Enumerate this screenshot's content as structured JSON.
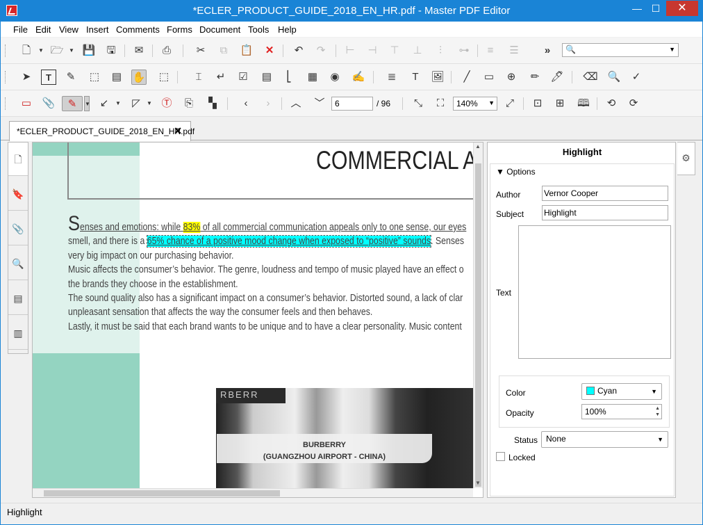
{
  "window": {
    "title": "*ECLER_PRODUCT_GUIDE_2018_EN_HR.pdf - Master PDF Editor",
    "controls": {
      "minimize": "—",
      "maximize": "☐",
      "close": "✕"
    }
  },
  "menu": [
    "File",
    "Edit",
    "View",
    "Insert",
    "Comments",
    "Forms",
    "Document",
    "Tools",
    "Help"
  ],
  "toolbar": {
    "overflow": "»",
    "page_current": "6",
    "page_total": "/ 96",
    "zoom": "140%"
  },
  "tab": {
    "label": "*ECLER_PRODUCT_GUIDE_2018_EN_HR.pdf",
    "close": "✕"
  },
  "document": {
    "headline": "COMMERCIAL A",
    "dropcap": "S",
    "lines": [
      {
        "pre": "enses and emotions: while ",
        "hl": "83%",
        "post": " of all commercial communication appeals only to one sense, our eyes"
      },
      {
        "pre": "smell, and there is a ",
        "hl": "65% chance of a positive mood change when exposed to “positive” sounds",
        "post": ".  Senses"
      },
      {
        "text": "very big impact on our purchasing behavior."
      },
      {
        "text": "Music affects the consumer’s behavior. The genre, loudness and tempo of music played have an effect o"
      },
      {
        "text": "the brands they choose in the establishment."
      },
      {
        "text": "The sound quality also has a significant impact on a consumer’s behavior. Distorted sound, a lack of clar"
      },
      {
        "text": "unpleasant sensation that affects the way the consumer feels and then behaves."
      },
      {
        "text": "Lastly, it must be said that each brand wants to be unique and to have a clear personality. Music content"
      }
    ],
    "photo_sign": "RBERR",
    "caption": [
      "BURBERRY",
      "(GUANGZHOU AIRPORT - CHINA)"
    ]
  },
  "panel": {
    "title": "Highlight",
    "options_header": "Options",
    "author_label": "Author",
    "author_value": "Vernor Cooper",
    "subject_label": "Subject",
    "subject_value": "Highlight",
    "text_label": "Text",
    "color_label": "Color",
    "color_value": "Cyan",
    "color_hex": "#00ffff",
    "opacity_label": "Opacity",
    "opacity_value": "100%",
    "status_label": "Status",
    "status_value": "None",
    "locked_label": "Locked"
  },
  "status": {
    "text": "Highlight"
  }
}
